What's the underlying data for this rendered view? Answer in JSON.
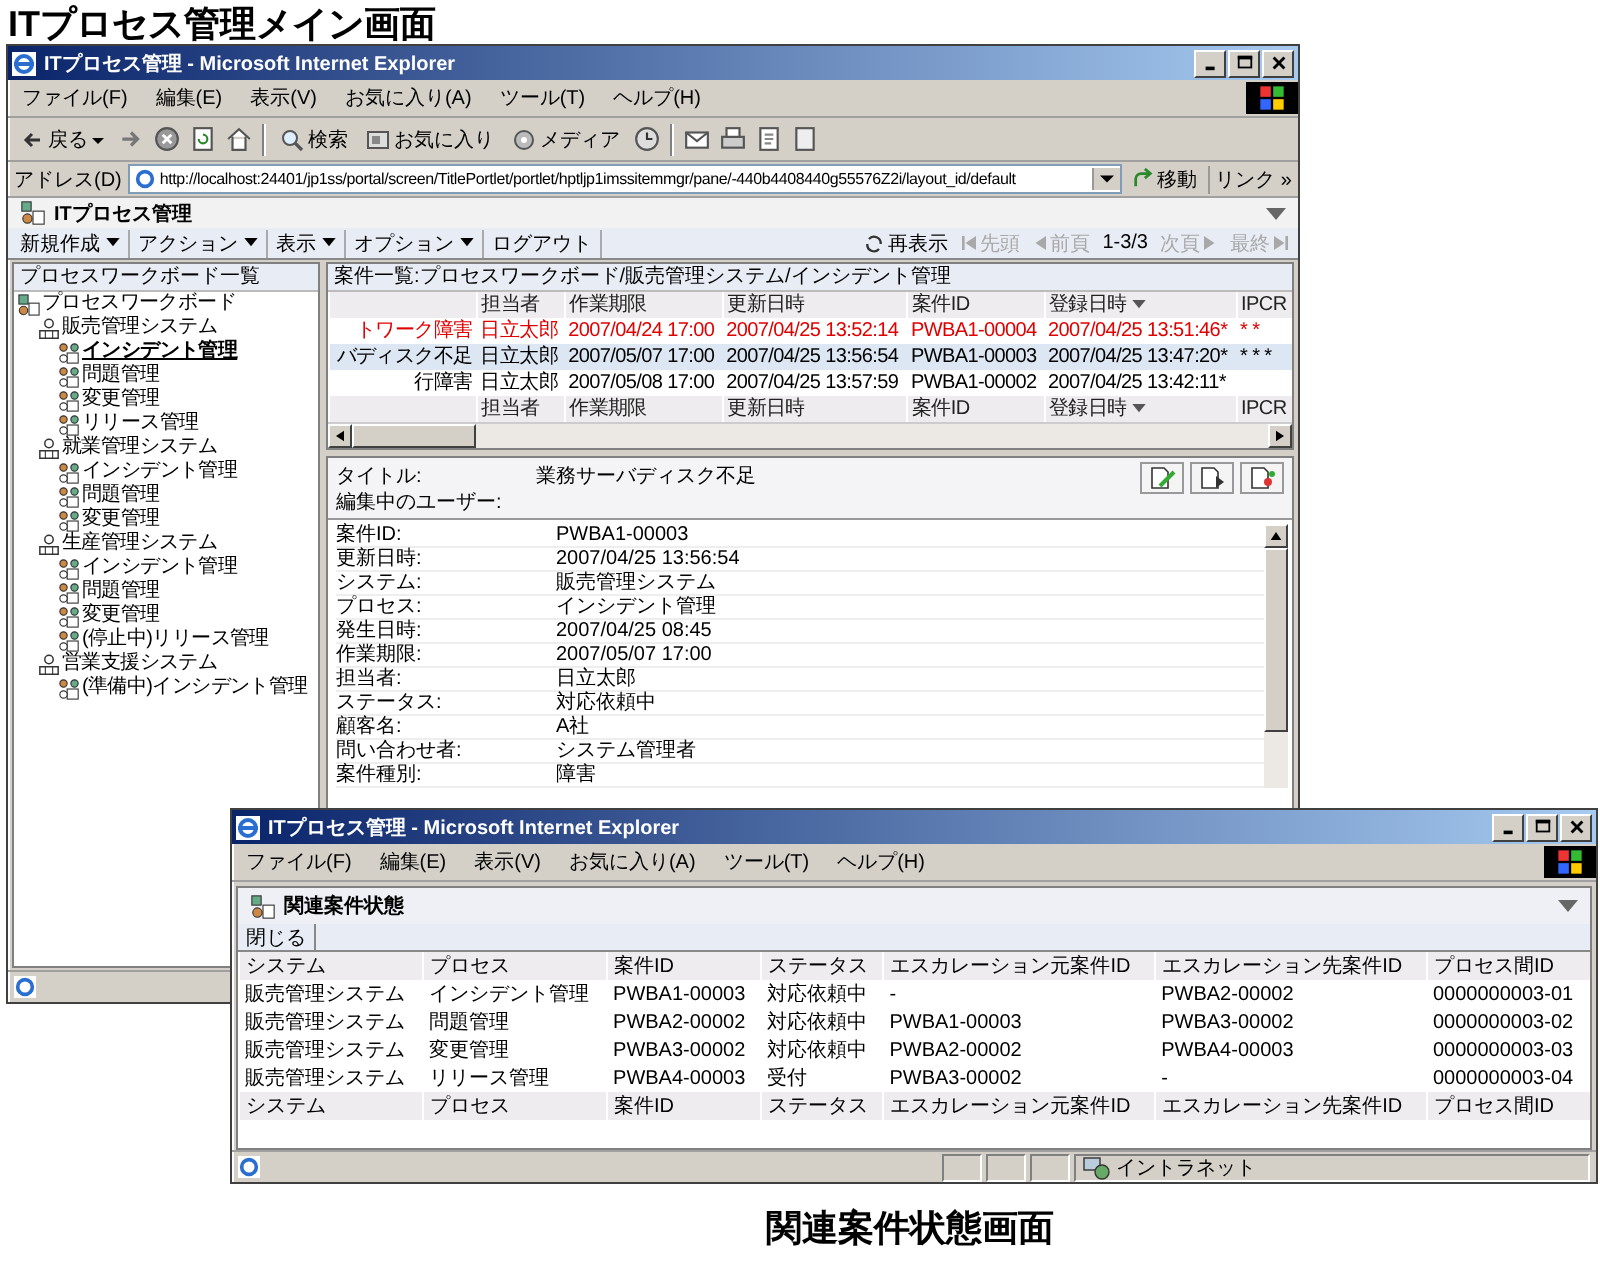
{
  "heading": "ITプロセス管理メイン画面",
  "main_window": {
    "title": "ITプロセス管理 - Microsoft Internet Explorer",
    "menu": [
      "ファイル(F)",
      "編集(E)",
      "表示(V)",
      "お気に入り(A)",
      "ツール(T)",
      "ヘルプ(H)"
    ],
    "toolbar": {
      "back": "戻る",
      "search": "検索",
      "favorites": "お気に入り",
      "media": "メディア"
    },
    "address": {
      "label": "アドレス(D)",
      "url": "http://localhost:24401/jp1ss/portal/screen/TitlePortlet/portlet/hptljp1imssitemmgr/pane/-440b4408440g55576Z2i/layout_id/default",
      "go": "移動",
      "links": "リンク",
      "links_more": "»"
    },
    "portal_title": "ITプロセス管理",
    "portal_menu": [
      {
        "label": "新規作成",
        "dropdown": true
      },
      {
        "label": "アクション",
        "dropdown": true
      },
      {
        "label": "表示",
        "dropdown": true
      },
      {
        "label": "オプション",
        "dropdown": true
      },
      {
        "label": "ログアウト",
        "dropdown": false
      }
    ],
    "refresh": "再表示",
    "pager": [
      {
        "label": "先頭",
        "disabled": true
      },
      {
        "label": "前頁",
        "disabled": true
      },
      {
        "label": "次頁",
        "disabled": true
      },
      {
        "label": "最終",
        "disabled": true
      }
    ],
    "page_count": "1-3/3",
    "tree": {
      "header": "プロセスワークボード一覧",
      "root": {
        "label": "プロセスワークボード",
        "selected": false,
        "children": [
          {
            "label": "販売管理システム",
            "selected": false,
            "children": [
              {
                "label": "インシデント管理",
                "selected": true
              },
              {
                "label": "問題管理",
                "selected": false
              },
              {
                "label": "変更管理",
                "selected": false
              },
              {
                "label": "リリース管理",
                "selected": false
              }
            ]
          },
          {
            "label": "就業管理システム",
            "selected": false,
            "children": [
              {
                "label": "インシデント管理",
                "selected": false
              },
              {
                "label": "問題管理",
                "selected": false
              },
              {
                "label": "変更管理",
                "selected": false
              }
            ]
          },
          {
            "label": "生産管理システム",
            "selected": false,
            "children": [
              {
                "label": "インシデント管理",
                "selected": false
              },
              {
                "label": "問題管理",
                "selected": false
              },
              {
                "label": "変更管理",
                "selected": false
              },
              {
                "label": "(停止中)リリース管理",
                "selected": false
              }
            ]
          },
          {
            "label": "営業支援システム",
            "selected": false,
            "children": [
              {
                "label": "(準備中)インシデント管理",
                "selected": false
              }
            ]
          }
        ]
      }
    },
    "case_list": {
      "header": "案件一覧:プロセスワークボード/販売管理システム/インシデント管理",
      "columns": [
        {
          "sorted": false
        },
        {
          "label": "担当者",
          "sorted": false
        },
        {
          "label": "作業期限",
          "sorted": false
        },
        {
          "label": "更新日時",
          "sorted": false
        },
        {
          "label": "案件ID",
          "sorted": false
        },
        {
          "label": "登録日時",
          "sorted": true
        },
        {
          "label": "IPCR",
          "sorted": false
        }
      ],
      "rows": [
        {
          "cells": [
            "トワーク障害",
            "日立太郎",
            "2007/04/24 17:00",
            "2007/04/25 13:52:14",
            "PWBA1-00004",
            "2007/04/25 13:51:46*",
            "* *"
          ],
          "selected": false,
          "overdue": true
        },
        {
          "cells": [
            "バディスク不足",
            "日立太郎",
            "2007/05/07 17:00",
            "2007/04/25 13:56:54",
            "PWBA1-00003",
            "2007/04/25 13:47:20*",
            "* * *"
          ],
          "selected": true,
          "overdue": false
        },
        {
          "cells": [
            "行障害",
            "日立太郎",
            "2007/05/08 17:00",
            "2007/04/25 13:57:59",
            "PWBA1-00002",
            "2007/04/25 13:42:11*",
            ""
          ],
          "selected": false,
          "overdue": false
        }
      ],
      "footer_columns": [
        {
          "sorted": false
        },
        {
          "label": "担当者",
          "sorted": false
        },
        {
          "label": "作業期限",
          "sorted": false
        },
        {
          "label": "更新日時",
          "sorted": false
        },
        {
          "label": "案件ID",
          "sorted": false
        },
        {
          "label": "登録日時",
          "sorted": true
        },
        {
          "label": "IPCR",
          "sorted": false
        }
      ]
    },
    "detail": {
      "title_label": "タイトル:",
      "title": "業務サーバディスク不足",
      "editing_label": "編集中のユーザー:",
      "fields": [
        {
          "label": "案件ID:",
          "value": "PWBA1-00003"
        },
        {
          "label": "更新日時:",
          "value": "2007/04/25 13:56:54"
        },
        {
          "label": "システム:",
          "value": "販売管理システム"
        },
        {
          "label": "プロセス:",
          "value": "インシデント管理"
        },
        {
          "label": "発生日時:",
          "value": "2007/04/25 08:45"
        },
        {
          "label": "作業期限:",
          "value": "2007/05/07 17:00"
        },
        {
          "label": "担当者:",
          "value": "日立太郎"
        },
        {
          "label": "ステータス:",
          "value": "対応依頼中"
        },
        {
          "label": "顧客名:",
          "value": "A社"
        },
        {
          "label": "問い合わせ者:",
          "value": "システム管理者"
        },
        {
          "label": "案件種別:",
          "value": "障害"
        }
      ]
    }
  },
  "related_window": {
    "title": "ITプロセス管理 - Microsoft Internet Explorer",
    "menu": [
      "ファイル(F)",
      "編集(E)",
      "表示(V)",
      "お気に入り(A)",
      "ツール(T)",
      "ヘルプ(H)"
    ],
    "portal_title": "関連案件状態",
    "close": "閉じる",
    "columns": [
      "システム",
      "プロセス",
      "案件ID",
      "ステータス",
      "エスカレーション元案件ID",
      "エスカレーション先案件ID",
      "プロセス間ID"
    ],
    "rows": [
      [
        "販売管理システム",
        "インシデント管理",
        "PWBA1-00003",
        "対応依頼中",
        "-",
        "PWBA2-00002",
        "0000000003-01"
      ],
      [
        "販売管理システム",
        "問題管理",
        "PWBA2-00002",
        "対応依頼中",
        "PWBA1-00003",
        "PWBA3-00002",
        "0000000003-02"
      ],
      [
        "販売管理システム",
        "変更管理",
        "PWBA3-00002",
        "対応依頼中",
        "PWBA2-00002",
        "PWBA4-00003",
        "0000000003-03"
      ],
      [
        "販売管理システム",
        "リリース管理",
        "PWBA4-00003",
        "受付",
        "PWBA3-00002",
        "-",
        "0000000003-04"
      ]
    ],
    "footer_columns": [
      "システム",
      "プロセス",
      "案件ID",
      "ステータス",
      "エスカレーション元案件ID",
      "エスカレーション先案件ID",
      "プロセス間ID"
    ],
    "zone": "イントラネット"
  },
  "caption": "関連案件状態画面"
}
